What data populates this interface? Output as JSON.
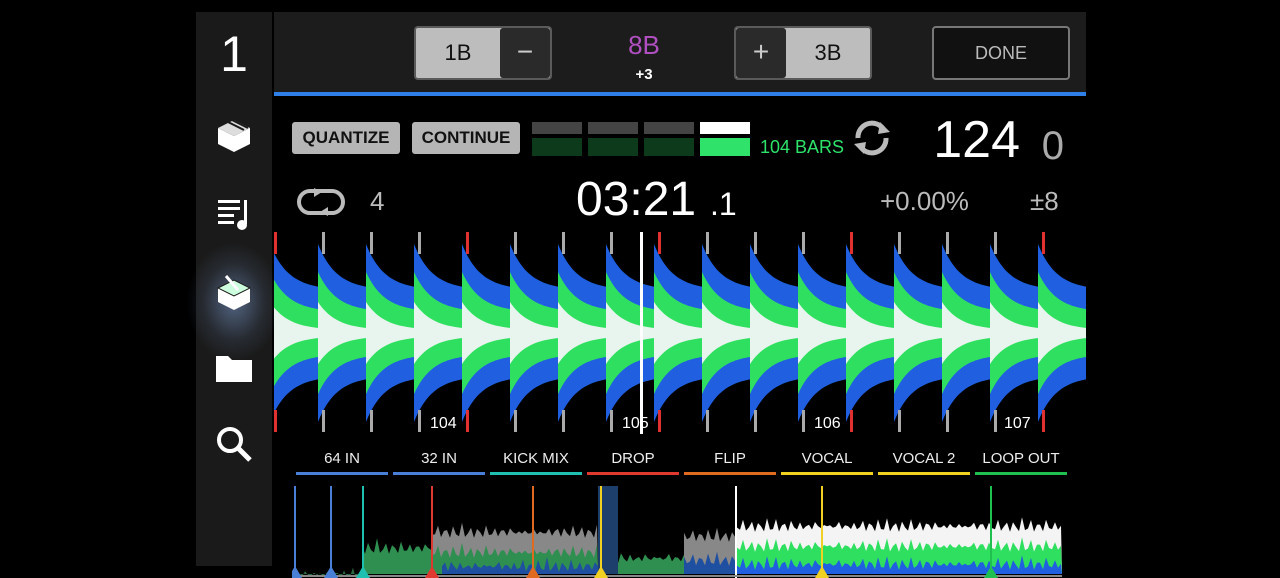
{
  "deck": {
    "number": "1"
  },
  "sidebar": {
    "items": [
      {
        "name": "collection-icon"
      },
      {
        "name": "playlist-icon"
      },
      {
        "name": "edit-icon"
      },
      {
        "name": "folder-icon"
      },
      {
        "name": "search-icon"
      }
    ]
  },
  "beatjump": {
    "left_value": "1B",
    "minus": "−",
    "center_value": "8B",
    "center_offset": "+3",
    "plus": "+",
    "right_value": "3B",
    "done": "DONE"
  },
  "controls": {
    "quantize": "QUANTIZE",
    "continue": "CONTINUE",
    "bars": "104 BARS",
    "bpm_int": "124",
    "bpm_dec": "0",
    "beat_count": "4",
    "time_main": "03:21",
    "time_frac": ".1",
    "pitch": "+0.00%",
    "range": "±8"
  },
  "colors": {
    "accent": "#2f7fe8",
    "wave_blue": "#1f5fe0",
    "wave_green": "#2fe060",
    "center_value": "#b04fc0"
  },
  "waveform": {
    "bar_numbers": [
      "104",
      "105",
      "106",
      "107"
    ]
  },
  "hotcues": [
    {
      "label": "64 IN",
      "color": "#4a7fd8"
    },
    {
      "label": "32 IN",
      "color": "#4a7fd8"
    },
    {
      "label": "KICK MIX",
      "color": "#20c0b0"
    },
    {
      "label": "DROP",
      "color": "#e03a30"
    },
    {
      "label": "FLIP",
      "color": "#e06a20"
    },
    {
      "label": "VOCAL",
      "color": "#f0d020"
    },
    {
      "label": "VOCAL 2",
      "color": "#f0d020"
    },
    {
      "label": "LOOP OUT",
      "color": "#20c050"
    }
  ]
}
